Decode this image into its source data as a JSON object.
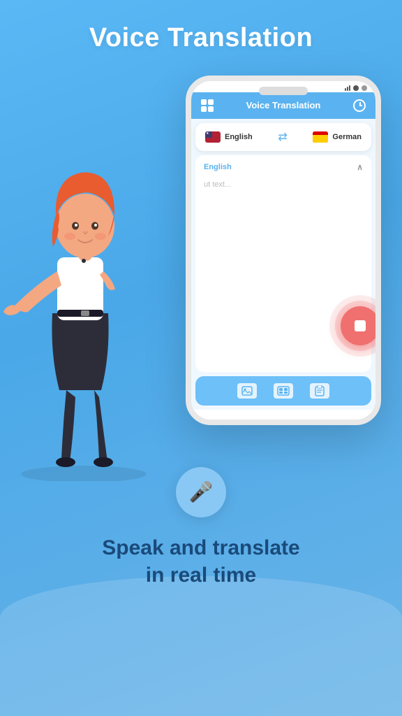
{
  "header": {
    "title": "Voice Translation"
  },
  "app": {
    "name": "Voice Translation",
    "source_lang": "English",
    "target_lang": "German",
    "placeholder": "ut text...",
    "translation_label": "English"
  },
  "bottom_text": {
    "line1": "Speak and translate",
    "line2": "in real time"
  },
  "toolbar": {
    "icons": [
      "image",
      "scan",
      "clipboard"
    ]
  }
}
